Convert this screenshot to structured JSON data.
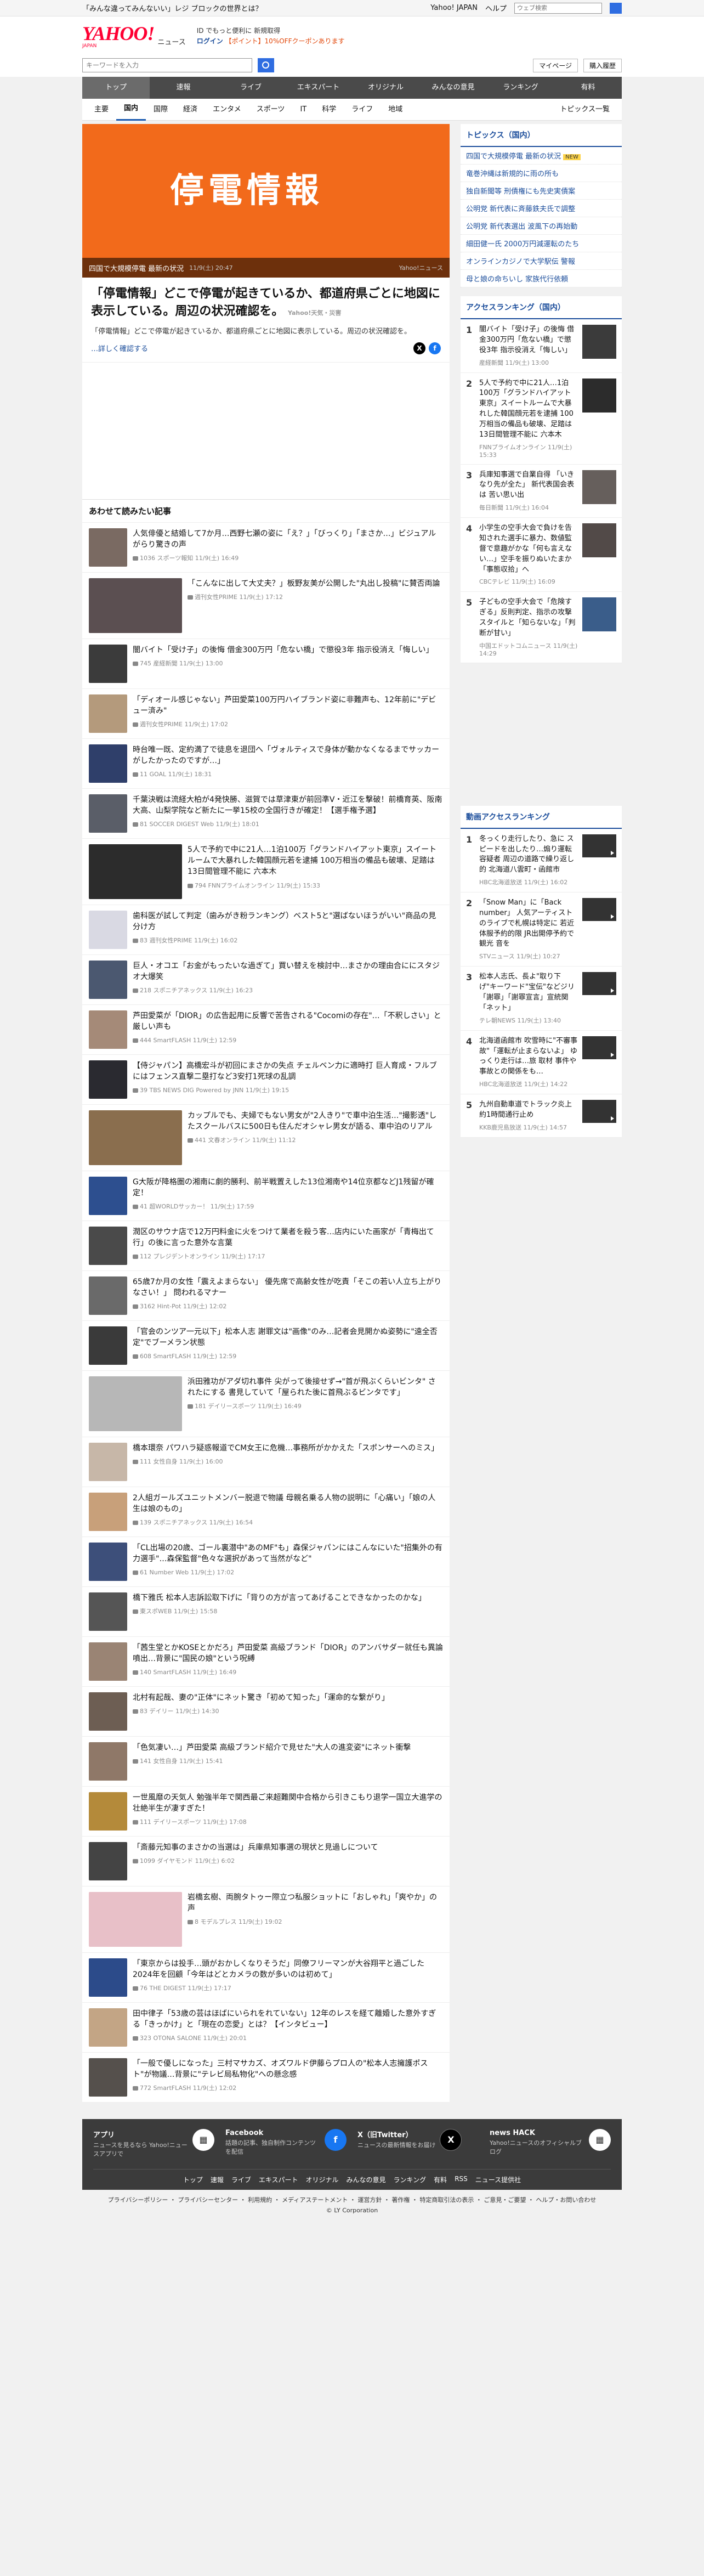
{
  "topbar": {
    "notice": "「みんな違ってみんないい」レジ ブロックの世界とは？",
    "links": [
      "Yahoo! JAPAN",
      "ヘルプ"
    ],
    "search_placeholder": "ウェブ検索"
  },
  "header": {
    "logo": "YAHOO!",
    "logo_sub": "ニュース",
    "logo_jp": "JAPAN",
    "login_line1": "ID でもっと便利に 新規取得",
    "login_label": "ログイン",
    "coupon": "【ポイント】10%OFFクーポンあります"
  },
  "search": {
    "placeholder": "キーワードを入力",
    "mypage": "マイページ",
    "premium": "購入履歴"
  },
  "nav": [
    "トップ",
    "速報",
    "ライブ",
    "エキスパート",
    "オリジナル",
    "みんなの意見",
    "ランキング",
    "有料"
  ],
  "subnav": [
    "主要",
    "国内",
    "国際",
    "経済",
    "エンタメ",
    "スポーツ",
    "IT",
    "科学",
    "ライフ",
    "地域"
  ],
  "subnav_right": "トピックス一覧",
  "hero": {
    "title": "停電情報",
    "caption": "四国で大規模停電 最新の状況",
    "time": "11/9(土) 20:47",
    "source": "Yahoo!ニュース"
  },
  "article": {
    "title": "「停電情報」どこで停電が起きているか、都道府県ごとに地図に表示している。周辺の状況確認を。",
    "meta": "Yahoo!天気・災害",
    "body": "「停電情報」どこで停電が起きているか、都道府県ごとに地図に表示している。周辺の状況確認を。",
    "more": "…詳しく確認する"
  },
  "related_heading": "あわせて読みたい記事",
  "related": [
    {
      "title": "人気俳優と結婚して7か月…西野七瀬の姿に「え？」「びっくり」「まさか…」ビジュアルがらり驚きの声",
      "meta": "1036 スポーツ報知 11/9(土) 16:49",
      "color": "#7a6a62"
    },
    {
      "title": "「こんなに出して大丈夫？」板野友美が公開した\"丸出し投稿\"に賛否両論",
      "meta": "週刊女性PRIME 11/9(土) 17:12",
      "color": "#5b4f51",
      "big": true
    },
    {
      "title": "闇バイト「受け子」の後悔 借金300万円「危ない橋」で懲役3年 指示役消え「悔しい」",
      "meta": "745 産経新聞 11/9(土) 13:00",
      "color": "#3b3b3b"
    },
    {
      "title": "「ディオール感じゃない」芦田愛菜100万円ハイブランド姿に非難声も、12年前に\"デビュー済み\"",
      "meta": "週刊女性PRIME 11/9(土) 17:02",
      "color": "#b49a7c"
    },
    {
      "title": "時台唯一既、定約満了で徒息を退団へ「ヴォルティスで身体が動かなくなるまでサッカーがしたかったのですが…」",
      "meta": "11 GOAL 11/9(土) 18:31",
      "color": "#2f3f6a"
    },
    {
      "title": "千葉決戦は流経大柏が4発快勝、滋賀では草津東が前回準V・近江を撃破！前橋育英、阪南大高、山梨学院など新たに一挙15校の全国行きが確定！【選手権予選】",
      "meta": "81 SOCCER DIGEST Web 11/9(土) 18:01",
      "color": "#5a5e68"
    },
    {
      "title": "5人で予約で中に21人…1泊100万「グランドハイアット東京」スイートルームで大暴れした韓国顔元若を逮捕 100万相当の備品も破壊、足踏は13日間管理不能に 六本木",
      "meta": "794 FNNプライムオンライン 11/9(土) 15:33",
      "color": "#2c2c2c",
      "big": true
    },
    {
      "title": "歯科医が試して判定（歯みがき粉ランキング）ベスト5と\"選ばないほうがいい\"商品の見分け方",
      "meta": "83 週刊女性PRIME 11/9(土) 16:02",
      "color": "#d9d9e3"
    },
    {
      "title": "巨人・オコエ「お金がもったいな過ぎて」買い替えを検討中…まさかの理由合ににスタジオ大爆笑",
      "meta": "218 スポニチアネックス 11/9(土) 16:23",
      "color": "#4b5870"
    },
    {
      "title": "芦田愛菜が「DIOR」の広告起用に反響で苦告される\"Cocomiの存在\"…「不釈しさい」と厳しい声も",
      "meta": "444 SmartFLASH 11/9(土) 12:59",
      "color": "#a58a78"
    },
    {
      "title": "【侍ジャパン】高橋宏斗が初回にまさかの失点 チェルベン力に適時打 巨人育成・フルブにはフェンス直撃二塁打など3安打1死球の乱調",
      "meta": "39 TBS NEWS DIG Powered by JNN 11/9(土) 19:15",
      "color": "#2a2a30"
    },
    {
      "title": "カップルでも、夫婦でもない男女が\"2人きり\"で車中泊生活…\"撮影透\"したスクールバスに500日も住んだオシャレ男女が語る、車中泊のリアル",
      "meta": "441 文春オンライン 11/9(土) 11:12",
      "color": "#8a6e4e",
      "big": true
    },
    {
      "title": "G大阪が降格圏の湘南に劇的勝利、前半戦置えした13位湘南や14位京都などJ1残留が確定！",
      "meta": "41 超WORLDサッカー！ 11/9(土) 17:59",
      "color": "#2d4f8f"
    },
    {
      "title": "潤区のサウナ店で12万円料金に火をつけて業者を殺う客…店内にいた画家が「青梅出て行」の後に言った意外な言葉",
      "meta": "112 プレジデントオンライン 11/9(土) 17:17",
      "color": "#4a4a4a"
    },
    {
      "title": "65歳7か月の女性「震えよまらない」 優先席で高齢女性が吃責「そこの若い人立ち上がりなさい！」 問われるマナー",
      "meta": "3162 Hint-Pot 11/9(土) 12:02",
      "color": "#6a6a6a"
    },
    {
      "title": "「官会のンツア一元以下」松本人志 謝罪文は\"画像\"のみ…記者会見開かぬ姿勢に\"遠全否定\"でブーメラン状態",
      "meta": "608 SmartFLASH 11/9(土) 12:59",
      "color": "#3a3a3a"
    },
    {
      "title": "浜田雅功がアダ切れ事件 尖がって後接せず→\"首が飛ぶくらいビンタ\" されたにする 書見していて「屋られた後に首飛ぶるビンタです」",
      "meta": "181 デイリースポーツ 11/9(土) 16:49",
      "color": "#b7b7b7",
      "big": true
    },
    {
      "title": "橋本環奈 パワハラ疑惑報道でCM女王に危機…事務所がかかえた「スポンサーへのミス」",
      "meta": "111 女性自身 11/9(土) 16:00",
      "color": "#c7b7a8"
    },
    {
      "title": "2人組ガールズユニットメンバー脱退で物議 母親名乗る人物の説明に「心痛い」「娘の人生は娘のもの」",
      "meta": "139 スポニチアネックス 11/9(土) 16:54",
      "color": "#c8a07a"
    },
    {
      "title": "「CL出場の20歳、ゴール裏潜中\"あのMF\"も」森保ジャパンにはこんなにいた\"招集外の有力選手\"…森保監督\"色々な選択があって当然がなど\"",
      "meta": "61 Number Web 11/9(土) 17:02",
      "color": "#3d4f7a"
    },
    {
      "title": "橋下雅氏 松本人志訴訟取下げに「背りの方が言ってあげることできなかったのかな」",
      "meta": "東スポWEB 11/9(土) 15:58",
      "color": "#555"
    },
    {
      "title": "「茜生堂とかKOSEとかだろ」芦田愛菜 高級ブランド「DIOR」のアンバサダー就任も異論噴出…背景に\"国民の娘\"という呪縛",
      "meta": "140 SmartFLASH 11/9(土) 16:49",
      "color": "#9a8474"
    },
    {
      "title": "北村有起哉、妻の\"正体\"にネット驚き「初めて知った」「運命的な繋がり」",
      "meta": "83 デイリー 11/9(土) 14:30",
      "color": "#6d5e53"
    },
    {
      "title": "「色気凄い…」芦田愛菜 高級ブランド紹介で見せた\"大人の進変姿\"にネット衝撃",
      "meta": "141 女性自身 11/9(土) 15:41",
      "color": "#8f7868"
    },
    {
      "title": "一世風靡の天気人 勉強半年で関西最ご来超難関中合格から引きこもり退学一国立大進学の壮絶半生が凄すぎた！",
      "meta": "111 デイリースポーツ 11/9(土) 17:08",
      "color": "#b48a3a"
    },
    {
      "title": "「斎藤元知事のまさかの当選は」兵庫県知事選の現状と見過しについて",
      "meta": "1099 ダイヤモンド 11/9(土) 6:02",
      "color": "#444"
    },
    {
      "title": "岩橋玄樹、両腕タトゥー際立つ私服ショットに「おしゃれ」「爽やか」の声",
      "meta": "8 モデルプレス 11/9(土) 19:02",
      "color": "#e8c0c8",
      "big": true
    },
    {
      "title": "「東京からは投手…頭がおかしくなりそうだ」同僚フリーマンが大谷翔平と過ごした2024年を回顧「今年はどとカメラの数が多いのは初めて」",
      "meta": "76 THE DIGEST 11/9(土) 17:17",
      "color": "#2c4b8a"
    },
    {
      "title": "田中律子「53歳の芸はほばにいられをれていない」12年のレスを経て離婚した意外すぎる「きっかけ」と「現在の恋愛」とは？【インタビュー】",
      "meta": "323 OTONA SALONE 11/9(土) 20:01",
      "color": "#c3a585"
    },
    {
      "title": "「一般で優しになった」三村マサカズ、オズワルド伊藤らプロ人の\"松本人志擁護ポスト\"が物議…背景に\"テレビ局私物化\"への懸念感",
      "meta": "772 SmartFLASH 11/9(土) 12:02",
      "color": "#55504c"
    }
  ],
  "side_topics_heading": "トピックス（国内）",
  "side_topics": [
    {
      "label": "四国で大規模停電 最新の状況",
      "tag": "NEW"
    },
    {
      "label": "竜巻沖縄は新規的に雨の所も"
    },
    {
      "label": "独自新聞等 刑債権にも先史実債案"
    },
    {
      "label": "公明党 新代表に斉藤鉄夫氏で調整"
    },
    {
      "label": "公明党 新代表選出 波風下の再始動"
    },
    {
      "label": "細田健一氏 2000万円減運転のたち"
    },
    {
      "label": "オンラインカジノで大学駅伝 警報"
    },
    {
      "label": "母と娘の命ちいし 家族代行依頼"
    }
  ],
  "access_heading": "アクセスランキング（国内）",
  "access_ranking": [
    {
      "title": "闇バイト「受け子」の後悔 借金300万円「危ない橋」で懲役3年 指示役消え「悔しい」",
      "meta": "産経新聞 11/9(土) 13:00",
      "color": "#3b3b3b"
    },
    {
      "title": "5人で予約で中に21人…1泊100万「グランドハイアット東京」スイートルームで大暴れした韓国顔元若を逮捕 100万相当の備品も破壊、足踏は13日間管理不能に 六本木",
      "meta": "FNNプライムオンライン 11/9(土) 15:33",
      "color": "#2c2c2c"
    },
    {
      "title": "兵庫知事選で自業自得 「いきなり先が全た」 新代表国会表は 苦い思い出",
      "meta": "毎日新聞 11/9(土) 16:04",
      "color": "#665f5c"
    },
    {
      "title": "小学生の空手大会で負けを告知された選手に暴力、数値監督で意趣がかな「何も言えない…」空手を振りぬいたまか「事態収拾」へ",
      "meta": "CBCテレビ 11/9(土) 16:09",
      "color": "#524a48"
    },
    {
      "title": "子どもの空手大会で「危険すぎる」反則判定、指示の攻撃スタイルと「知らないな」「判断が甘い」",
      "meta": "中国エドットコムニュース 11/9(土) 14:29",
      "color": "#3a5d8a"
    }
  ],
  "video_heading": "動画アクセスランキング",
  "video_ranking": [
    {
      "title": "冬っくり走行したり、急に スピードを出したり…煽り運転容疑者 周辺の道路で繰り返し的 北海道八雲町・函館市",
      "meta": "HBC北海道放送 11/9(土) 16:02"
    },
    {
      "title": "「Snow Man」に「Back number」 人気アーティストのライブで札幌は特定に 若近体服予約的限 JR出開停予約で観光 音を",
      "meta": "STVニュース 11/9(土) 10:27"
    },
    {
      "title": "松本人志氏、長よ\"取り下げ\"キーワード\"宝伝\"などジリ「謝罪」「謝罪宣言」宣統関「ネット」",
      "meta": "テレ朝NEWS 11/9(土) 13:40"
    },
    {
      "title": "北海道函館市 吹雪時に\"不審事故\"「運転が止まらないよ」 ゆっくり走行は…旅 取材 事件や事故との関係をも…",
      "meta": "HBC北海道放送 11/9(土) 14:22"
    },
    {
      "title": "九州自動車道でトラック炎上 約1時間通行止め",
      "meta": "KKB鹿児島放送 11/9(土) 14:57"
    }
  ],
  "footer": {
    "promos": [
      {
        "icon": "app-icon",
        "title": "アプリ",
        "desc": "ニュースを見るなら Yahoo!ニュースアプリで"
      },
      {
        "icon": "facebook-icon",
        "title": "Facebook",
        "desc": "話題の記事、独自制作コンテンツを配信"
      },
      {
        "icon": "x-icon",
        "title": "X（旧Twitter）",
        "desc": "ニュースの最新情報をお届け"
      },
      {
        "icon": "newshack-icon",
        "title": "news HACK",
        "desc": "Yahoo!ニュースのオフィシャルブログ"
      }
    ],
    "links": [
      "トップ",
      "速報",
      "ライブ",
      "エキスパート",
      "オリジナル",
      "みんなの意見",
      "ランキング",
      "有料",
      "RSS",
      "ニュース提供社"
    ],
    "legal_line1": "プライバシーポリシー ・ プライバシーセンター ・ 利用規約 ・ メディアステートメント ・ 運営方針 ・ 著作権 ・ 特定商取引法の表示 ・ ご意見・ご要望 ・ ヘルプ・お問い合わせ",
    "legal_line2": "© LY Corporation"
  }
}
